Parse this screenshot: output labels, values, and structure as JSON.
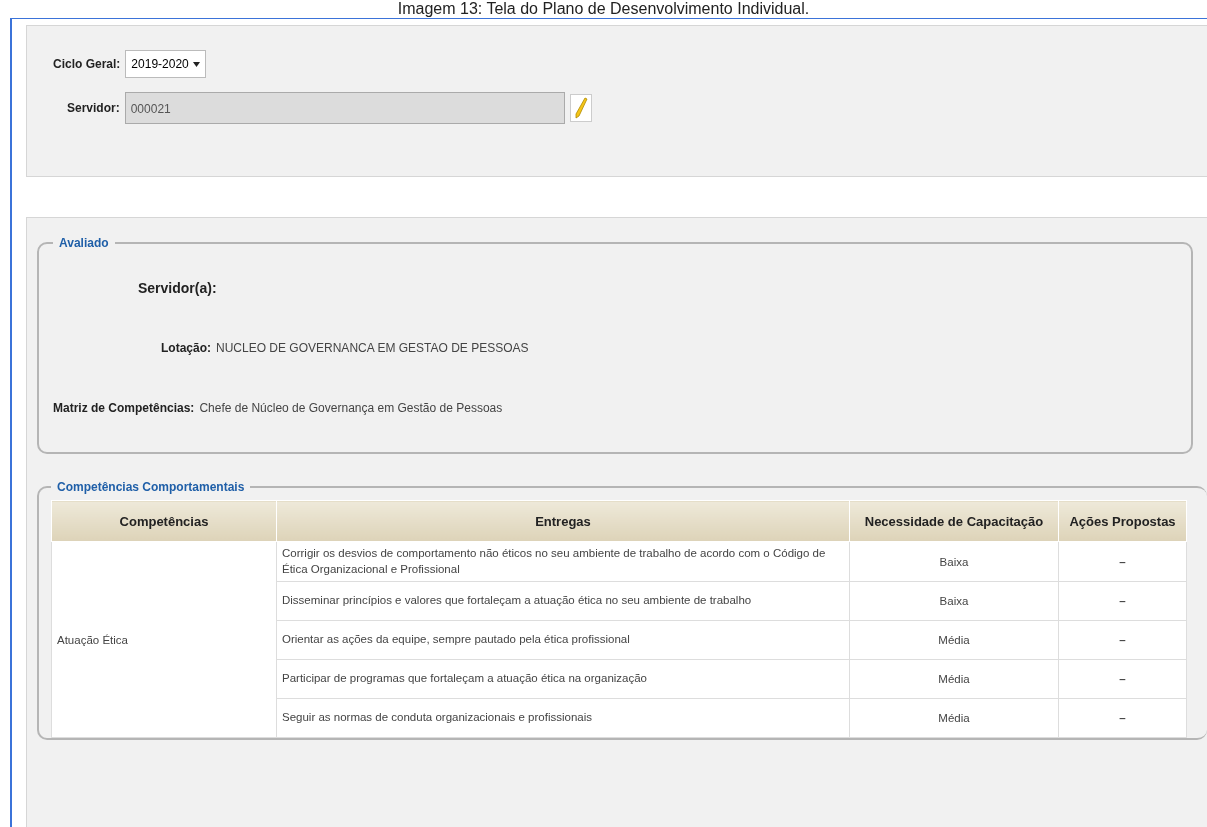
{
  "caption": "Imagem 13: Tela do Plano de Desenvolvimento Individual.",
  "filters": {
    "cycle_label": "Ciclo Geral:",
    "cycle_value": "2019-2020",
    "server_label": "Servidor:",
    "server_value": "000021"
  },
  "evaluated": {
    "legend": "Avaliado",
    "fields": [
      {
        "label": "Servidor(a):"
      },
      {
        "label": "Lotação:",
        "value": "NUCLEO DE GOVERNANCA EM GESTAO DE PESSOAS"
      },
      {
        "label": "Matriz de Competências:",
        "value": "Chefe de Núcleo de Governança em Gestão de Pessoas"
      }
    ]
  },
  "behavioral": {
    "legend": "Competências Comportamentais",
    "columns": [
      "Competências",
      "Entregas",
      "Necessidade de Capacitação",
      "Ações Propostas"
    ],
    "groups": [
      {
        "competence": "Atuação Ética",
        "rows": [
          {
            "delivery": "Corrigir os desvios de comportamento não éticos no seu ambiente de trabalho de acordo com o Código de Ética Organizacional e Profissional",
            "need": "Baixa",
            "actions": "–"
          },
          {
            "delivery": "Disseminar princípios e valores que fortaleçam a atuação ética no seu ambiente de trabalho",
            "need": "Baixa",
            "actions": "–"
          },
          {
            "delivery": "Orientar as ações da equipe, sempre pautado pela ética profissional",
            "need": "Média",
            "actions": "–"
          },
          {
            "delivery": "Participar de programas que fortaleçam a atuação ética na organização",
            "need": "Média",
            "actions": "–"
          },
          {
            "delivery": "Seguir as normas de conduta organizacionais e profissionais",
            "need": "Média",
            "actions": "–"
          }
        ]
      }
    ]
  }
}
